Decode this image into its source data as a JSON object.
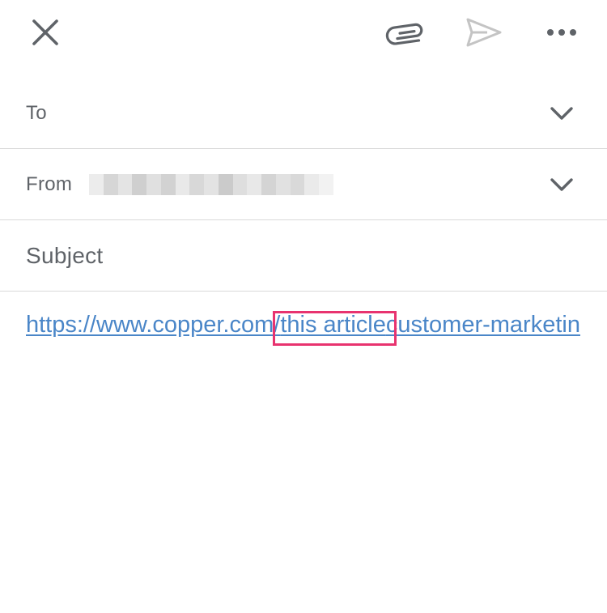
{
  "toolbar": {
    "close_icon": "close-icon",
    "attach_icon": "paperclip-icon",
    "send_icon": "send-icon",
    "more_icon": "more-horizontal-icon"
  },
  "fields": {
    "to_label": "To",
    "from_label": "From",
    "subject_label": "Subject"
  },
  "body": {
    "link_start": "https://www.copper.com/",
    "link_highlight": "this article",
    "link_end": "customer-marketin"
  },
  "colors": {
    "link": "#4a86c8",
    "highlight_border": "#e8336f",
    "icon": "#5f6368",
    "send_disabled": "#c4c4c4",
    "divider": "#d9d9d9"
  }
}
